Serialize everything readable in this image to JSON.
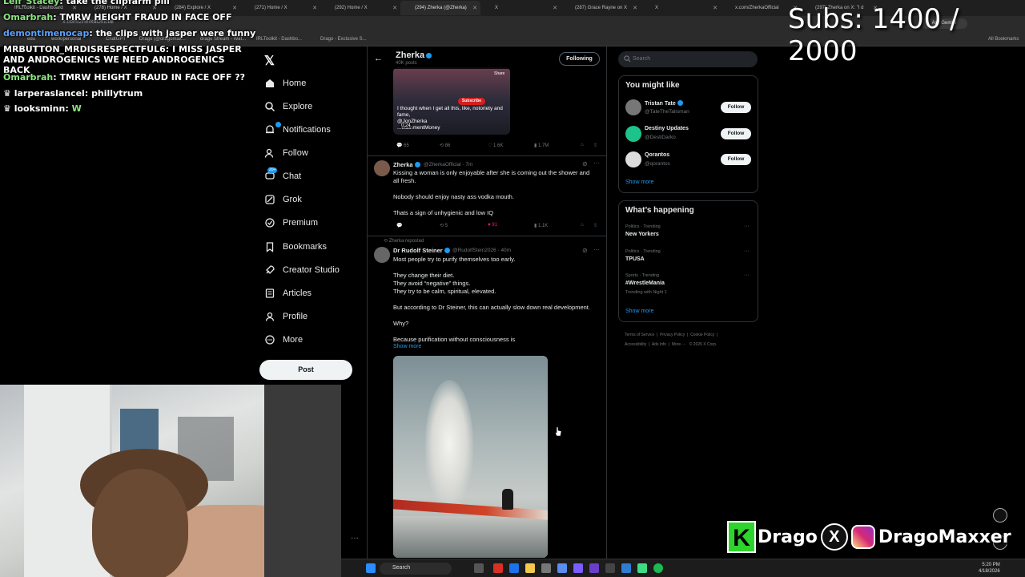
{
  "browser": {
    "tabs": [
      "IRLToolkit - Dashboard",
      "(278) Home / X",
      "(284) Explore / X",
      "(271) Home / X",
      "(292) Home / X",
      "(294) Zherka (@Zherka)",
      "X",
      "(287) Grace Rayne on X",
      "X",
      "x.com/ZherkaOfficial",
      "(297) Zherka on X: \"I d"
    ],
    "url": "x.com/ZherkaOfficial",
    "bookmarks": [
      "edu",
      "work/personal",
      "ChatGPT",
      "Drago (@dragomax...",
      "drago Stream - Wat...",
      "IRLToolkit - Dashbo...",
      "Drago - Exclusive S..."
    ],
    "all_bookmarks": "All Bookmarks",
    "ask_gemini": "Ask Gemini"
  },
  "chat": [
    {
      "user": "Leif_Stacey",
      "text": "take the clipfarm pill",
      "color": "#8be67f"
    },
    {
      "user": "Omarbrah",
      "text": "TMRW HEIGHT FRAUD IN FACE OFF",
      "color": "#8be67f"
    },
    {
      "user": "demontimenocap",
      "text": "the clips with jasper were funny",
      "color": "#5aa0ff"
    },
    {
      "user": "MRBUTTON_MRDISRESPECTFUL6",
      "text": "I MISS JASPER AND ANDROGENICS WE NEED ANDROGENICS BACK",
      "color": "#ffffff"
    },
    {
      "user": "Omarbrah",
      "text": "TMRW HEIGHT FRAUD IN FACE OFF ??",
      "color": "#8be67f"
    },
    {
      "user": "larperaslancel",
      "text": "phillytrum",
      "color": "#ffffff"
    },
    {
      "user": "looksminn",
      "text": "W",
      "color": "#ffffff"
    }
  ],
  "subs_counter": "Subs: 1400 / 2000",
  "nav": {
    "items": [
      "Home",
      "Explore",
      "Notifications",
      "Follow",
      "Chat",
      "Grok",
      "Premium",
      "Bookmarks",
      "Creator Studio",
      "Articles",
      "Profile",
      "More"
    ],
    "chat_badge": "20+",
    "post_label": "Post"
  },
  "profile": {
    "name": "Zherka",
    "posts_count": "40K posts",
    "following_label": "Following"
  },
  "video": {
    "caption": "I thought when I get all this, like, notoriety and fame,",
    "caption2": "@JonZherka",
    "caption3": "...etainmentMoney",
    "duration": "0:24",
    "subscribe": "Subscribe",
    "share": "Share",
    "remix": "Remix"
  },
  "tweet0_actions": {
    "replies": "65",
    "reposts": "86",
    "likes": "1.6K",
    "views": "1.7M"
  },
  "tweet1": {
    "name": "Zherka",
    "handle": "@ZherkaOfficial · 7m",
    "lines": [
      "Kissing a woman is only enjoyable after she is coming out the shower and",
      "all fresh.",
      "",
      "Nobody should enjoy nasty ass vodka mouth.",
      "",
      "Thats a sign of unhygienic and low IQ"
    ],
    "actions": {
      "replies": "",
      "reposts": "5",
      "likes": "91",
      "views": "1.1K"
    }
  },
  "tweet2": {
    "repost_label": "Zherka reposted",
    "name": "Dr Rudolf Steiner",
    "handle": "@RudolfStein2026 · 40m",
    "lines": [
      "Most people try to purify themselves too early.",
      "",
      "They change their diet.",
      "They avoid “negative” things.",
      "They try to be calm, spiritual, elevated.",
      "",
      "But according to Dr Steiner, this can actually slow down real development.",
      "",
      "Why?",
      "",
      "Because purification without consciousness is"
    ],
    "show_more": "Show more"
  },
  "search_placeholder": "Search",
  "who_to_follow": {
    "title": "You might like",
    "users": [
      {
        "name": "Tristan Tate",
        "handle": "@TateTheTalisman",
        "avatar_color": "#777777"
      },
      {
        "name": "Destiny Updates",
        "handle": "@DestiDarko",
        "avatar_color": "#1ec28b"
      },
      {
        "name": "Qorantos",
        "handle": "@qorantos",
        "avatar_color": "#dddddd"
      }
    ],
    "follow_label": "Follow",
    "show_more": "Show more"
  },
  "happening": {
    "title": "What’s happening",
    "trends": [
      {
        "category": "Politics · Trending",
        "name": "New Yorkers",
        "extra": ""
      },
      {
        "category": "Politics · Trending",
        "name": "TPUSA",
        "extra": ""
      },
      {
        "category": "Sports · Trending",
        "name": "#WrestleMania",
        "extra": "Trending with Night 1"
      }
    ],
    "show_more": "Show more"
  },
  "footer": [
    "Terms of Service",
    "Privacy Policy",
    "Cookie Policy",
    "Accessibility",
    "Ads info",
    "More ···",
    "© 2026 X Corp."
  ],
  "taskbar": {
    "search": "Search",
    "time": "5:20 PM",
    "date": "4/18/2026"
  },
  "watermark": {
    "k": "K",
    "name1": "Drago",
    "x": "X",
    "name2": "DragoMaxxer"
  },
  "colors": {
    "accent": "#1d9bf0",
    "like": "#f91880",
    "bg": "#000000",
    "border": "#2f3336"
  }
}
